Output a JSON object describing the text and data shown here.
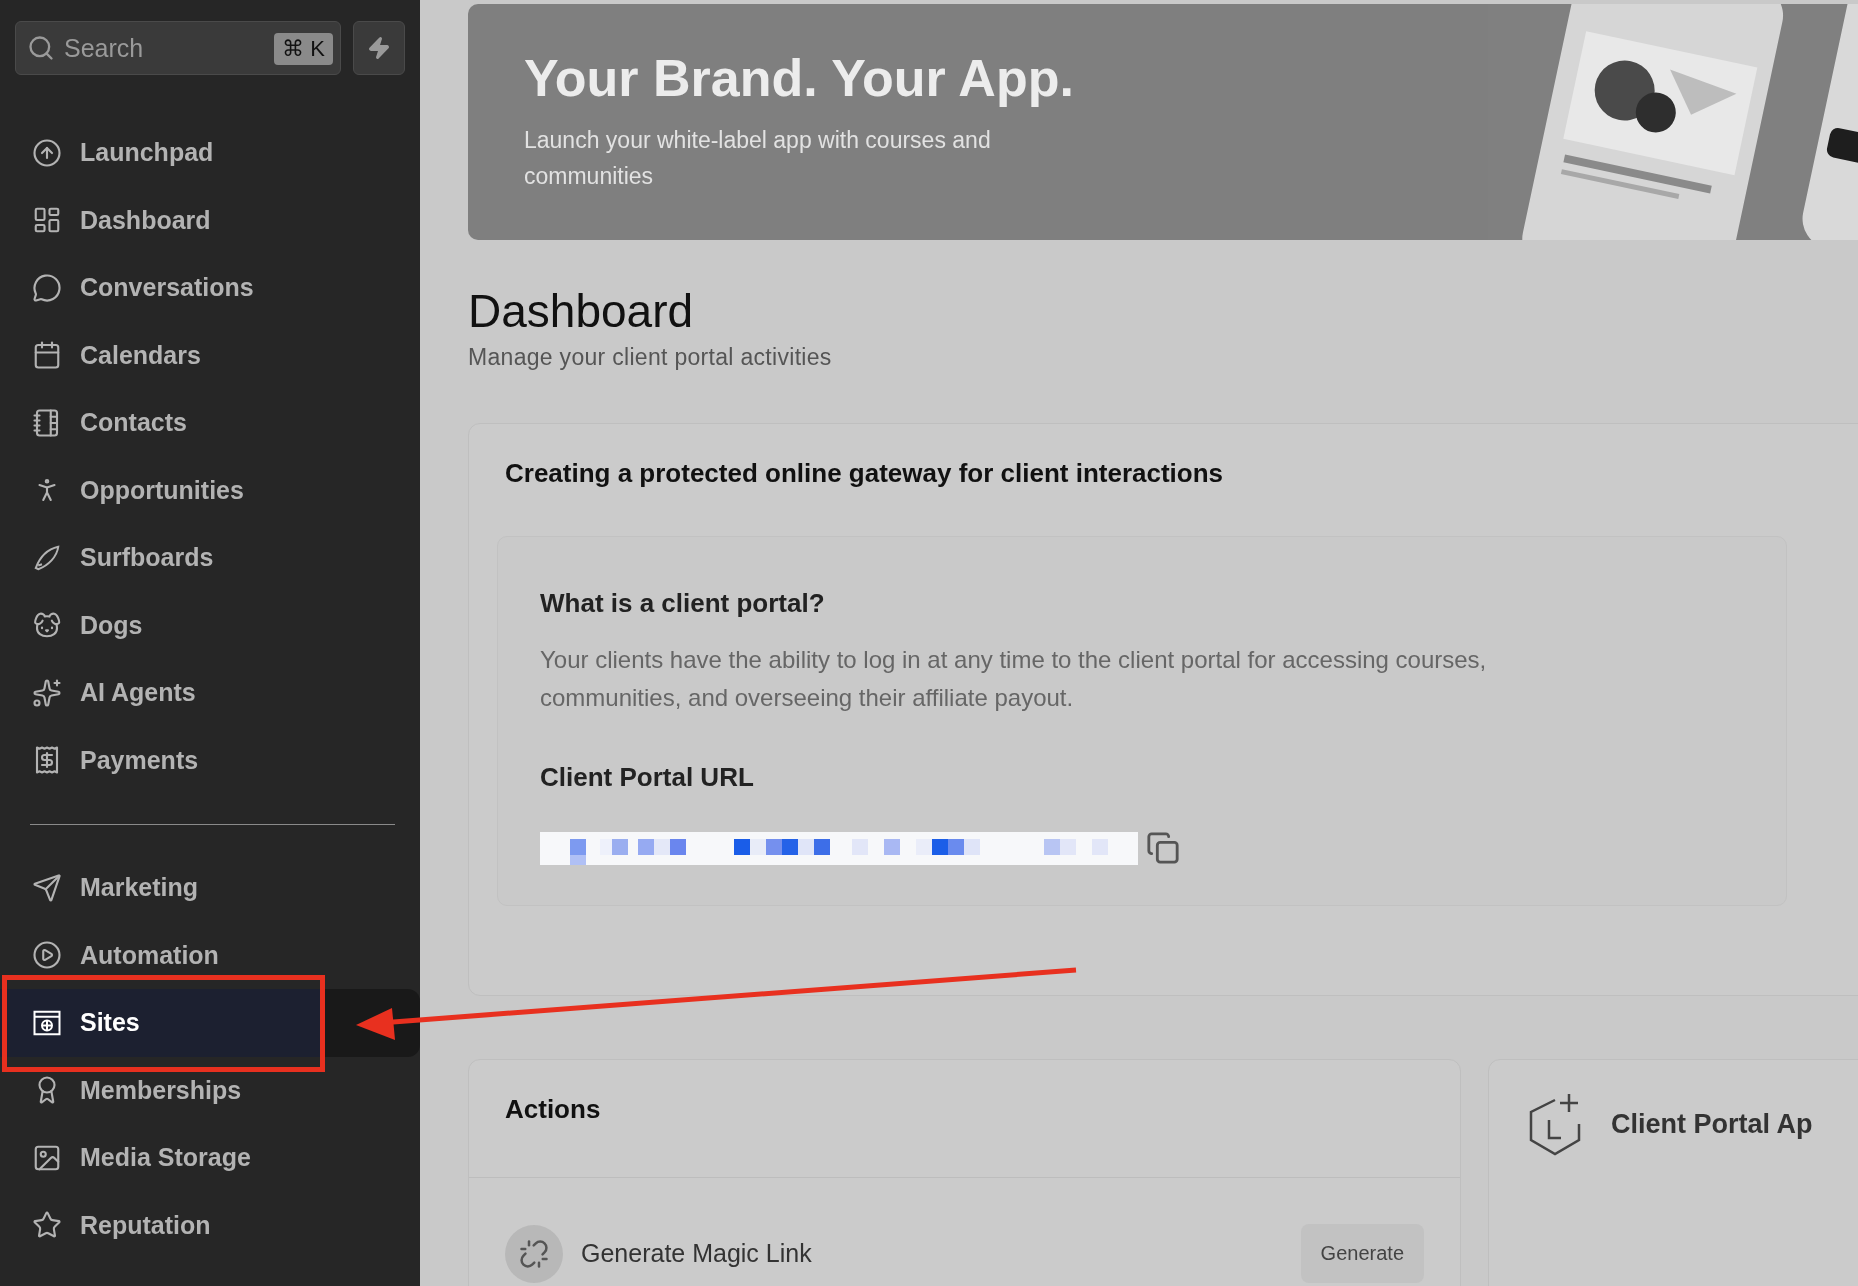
{
  "search": {
    "placeholder": "Search",
    "shortcut": "⌘ K"
  },
  "sidebar": {
    "groups": [
      {
        "items": [
          {
            "label": "Launchpad",
            "selected": false
          },
          {
            "label": "Dashboard",
            "selected": false
          },
          {
            "label": "Conversations",
            "selected": false
          },
          {
            "label": "Calendars",
            "selected": false
          },
          {
            "label": "Contacts",
            "selected": false
          },
          {
            "label": "Opportunities",
            "selected": false
          },
          {
            "label": "Surfboards",
            "selected": false
          },
          {
            "label": "Dogs",
            "selected": false
          },
          {
            "label": "AI Agents",
            "selected": false
          },
          {
            "label": "Payments",
            "selected": false
          }
        ]
      },
      {
        "items": [
          {
            "label": "Marketing",
            "selected": false
          },
          {
            "label": "Automation",
            "selected": false
          },
          {
            "label": "Sites",
            "selected": true
          },
          {
            "label": "Memberships",
            "selected": false
          },
          {
            "label": "Media Storage",
            "selected": false
          },
          {
            "label": "Reputation",
            "selected": false
          }
        ]
      }
    ]
  },
  "banner": {
    "title": "Your Brand. Your App.",
    "subtitle": "Launch your white-label app with courses and communities"
  },
  "page": {
    "title": "Dashboard",
    "subtitle": "Manage your client portal activities"
  },
  "portal_card": {
    "title": "Creating a protected online gateway for client interactions",
    "info": {
      "heading": "What is a client portal?",
      "body": "Your clients have the ability to log in at any time to the client portal for accessing courses, communities, and overseeing their affiliate payout.",
      "url_label": "Client Portal URL"
    }
  },
  "actions_card": {
    "title": "Actions",
    "rows": [
      {
        "label": "Generate Magic Link",
        "button": "Generate"
      }
    ]
  },
  "app_card": {
    "title": "Client Portal Ap"
  },
  "annotations": {
    "frame": {
      "color": "#e8301f"
    },
    "arrow": {
      "color": "#e8301f"
    }
  }
}
